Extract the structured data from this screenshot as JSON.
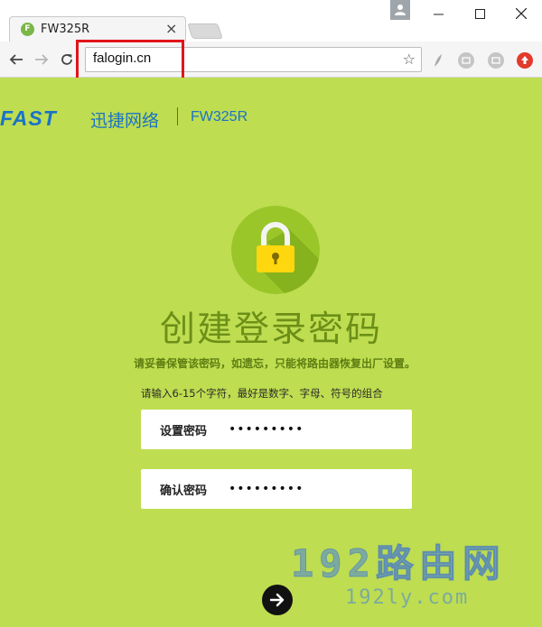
{
  "browser": {
    "tab_title": "FW325R",
    "tab_close": "×",
    "favicon_letter": "F",
    "url": "falogin.cn",
    "star": "☆"
  },
  "header": {
    "brand_logo": "FAST",
    "brand_name": "迅捷网络",
    "model": "FW325R"
  },
  "main": {
    "title": "创建登录密码",
    "warning": "请妥善保管该密码，如遗忘，只能将路由器恢复出厂设置。",
    "hint": "请输入6-15个字符，最好是数字、字母、符号的组合",
    "fields": [
      {
        "label": "设置密码",
        "value": "•••••••••"
      },
      {
        "label": "确认密码",
        "value": "•••••••••"
      }
    ]
  },
  "watermark": {
    "main": "192路由网",
    "sub": "192ly.com"
  },
  "colors": {
    "page_bg": "#bedd50",
    "brand_blue": "#1a73c6",
    "title_green": "#6c8f18",
    "highlight_red": "#e0151b"
  }
}
